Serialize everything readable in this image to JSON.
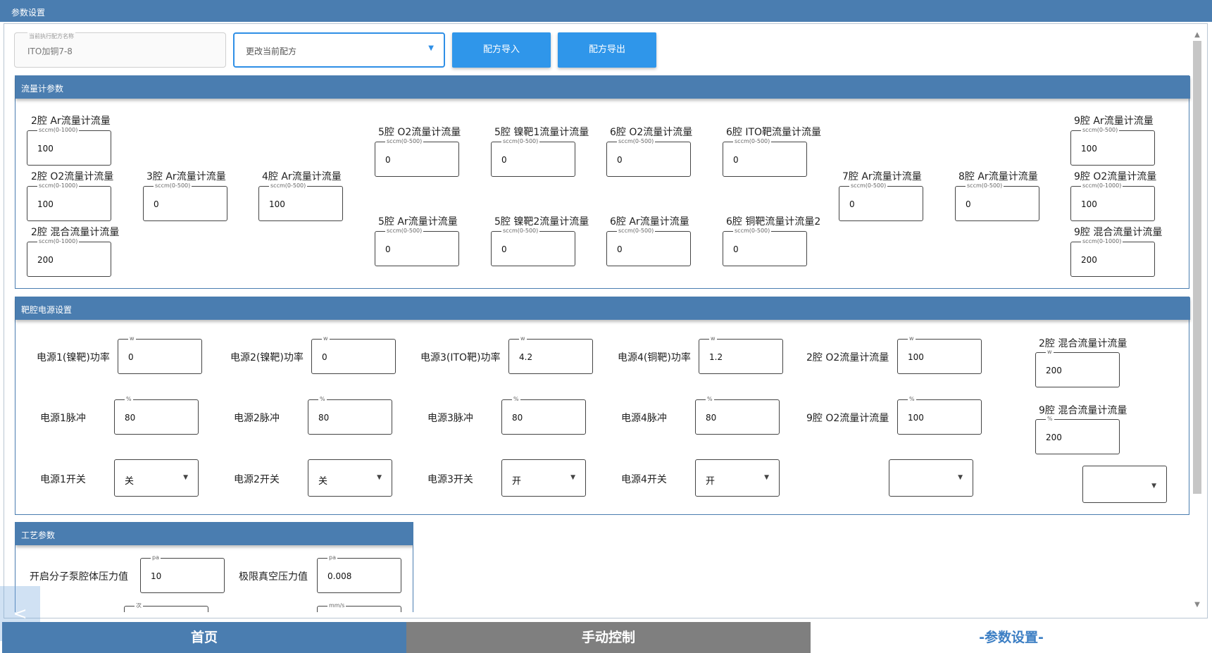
{
  "window": {
    "title": "参数设置"
  },
  "top": {
    "recipe_legend": "当前执行配方名称",
    "recipe_value": "ITO加铜7-8",
    "select_placeholder": "更改当前配方",
    "import_label": "配方导入",
    "export_label": "配方导出"
  },
  "flow": {
    "title": "流量计参数",
    "fields": [
      {
        "label": "2腔 Ar流量计流量",
        "unit": "sccm(0-1000)",
        "value": "100"
      },
      {
        "label": "2腔 O2流量计流量",
        "unit": "sccm(0-1000)",
        "value": "100"
      },
      {
        "label": "2腔 混合流量计流量",
        "unit": "sccm(0-1000)",
        "value": "200"
      },
      {
        "label": "3腔 Ar流量计流量",
        "unit": "sccm(0-500)",
        "value": "0"
      },
      {
        "label": "4腔 Ar流量计流量",
        "unit": "sccm(0-500)",
        "value": "100"
      },
      {
        "label": "5腔 O2流量计流量",
        "unit": "sccm(0-500)",
        "value": "0"
      },
      {
        "label": "5腔 Ar流量计流量",
        "unit": "sccm(0-500)",
        "value": "0"
      },
      {
        "label": "5腔 镍靶1流量计流量",
        "unit": "sccm(0-500)",
        "value": "0"
      },
      {
        "label": "5腔 镍靶2流量计流量",
        "unit": "sccm(0-500)",
        "value": "0"
      },
      {
        "label": "6腔 O2流量计流量",
        "unit": "sccm(0-500)",
        "value": "0"
      },
      {
        "label": "6腔 Ar流量计流量",
        "unit": "sccm(0-500)",
        "value": "0"
      },
      {
        "label": "6腔 ITO靶流量计流量",
        "unit": "sccm(0-500)",
        "value": "0"
      },
      {
        "label": "6腔 铜靶流量计流量2",
        "unit": "sccm(0-500)",
        "value": "0"
      },
      {
        "label": "7腔 Ar流量计流量",
        "unit": "sccm(0-500)",
        "value": "0"
      },
      {
        "label": "8腔 Ar流量计流量",
        "unit": "sccm(0-500)",
        "value": "0"
      },
      {
        "label": "9腔 Ar流量计流量",
        "unit": "sccm(0-500)",
        "value": "100"
      },
      {
        "label": "9腔 O2流量计流量",
        "unit": "sccm(0-1000)",
        "value": "100"
      },
      {
        "label": "9腔 混合流量计流量",
        "unit": "sccm(0-1000)",
        "value": "200"
      }
    ]
  },
  "power": {
    "title": "靶腔电源设置",
    "power_fields": [
      {
        "label": "电源1(镍靶)功率",
        "unit": "w",
        "value": "0"
      },
      {
        "label": "电源2(镍靶)功率",
        "unit": "w",
        "value": "0"
      },
      {
        "label": "电源3(ITO靶)功率",
        "unit": "w",
        "value": "4.2"
      },
      {
        "label": "电源4(铜靶)功率",
        "unit": "w",
        "value": "1.2"
      },
      {
        "label": "2腔 O2流量计流量",
        "unit": "w",
        "value": "100"
      },
      {
        "label": "2腔 混合流量计流量",
        "unit": "w",
        "value": "200"
      }
    ],
    "pulse_fields": [
      {
        "label": "电源1脉冲",
        "unit": "%",
        "value": "80"
      },
      {
        "label": "电源2脉冲",
        "unit": "%",
        "value": "80"
      },
      {
        "label": "电源3脉冲",
        "unit": "%",
        "value": "80"
      },
      {
        "label": "电源4脉冲",
        "unit": "%",
        "value": "80"
      },
      {
        "label": "9腔 O2流量计流量",
        "unit": "%",
        "value": "100"
      },
      {
        "label": "9腔 混合流量计流量",
        "unit": "%",
        "value": "200"
      }
    ],
    "switch_fields": [
      {
        "label": "电源1开关",
        "value": "关"
      },
      {
        "label": "电源2开关",
        "value": "关"
      },
      {
        "label": "电源3开关",
        "value": "开"
      },
      {
        "label": "电源4开关",
        "value": "开"
      },
      {
        "label": "",
        "value": ""
      },
      {
        "label": "",
        "value": ""
      }
    ]
  },
  "process": {
    "title": "工艺参数",
    "fields": [
      {
        "label": "开启分子泵腔体压力值",
        "unit": "pa",
        "value": "10"
      },
      {
        "label": "极限真空压力值",
        "unit": "pa",
        "value": "0.008"
      },
      {
        "label": "",
        "unit": "次",
        "value": ""
      },
      {
        "label": "",
        "unit": "mm/s",
        "value": ""
      }
    ]
  },
  "nav": {
    "home": "首页",
    "manual": "手动控制",
    "params": "-参数设置-"
  },
  "back_glyph": "<"
}
